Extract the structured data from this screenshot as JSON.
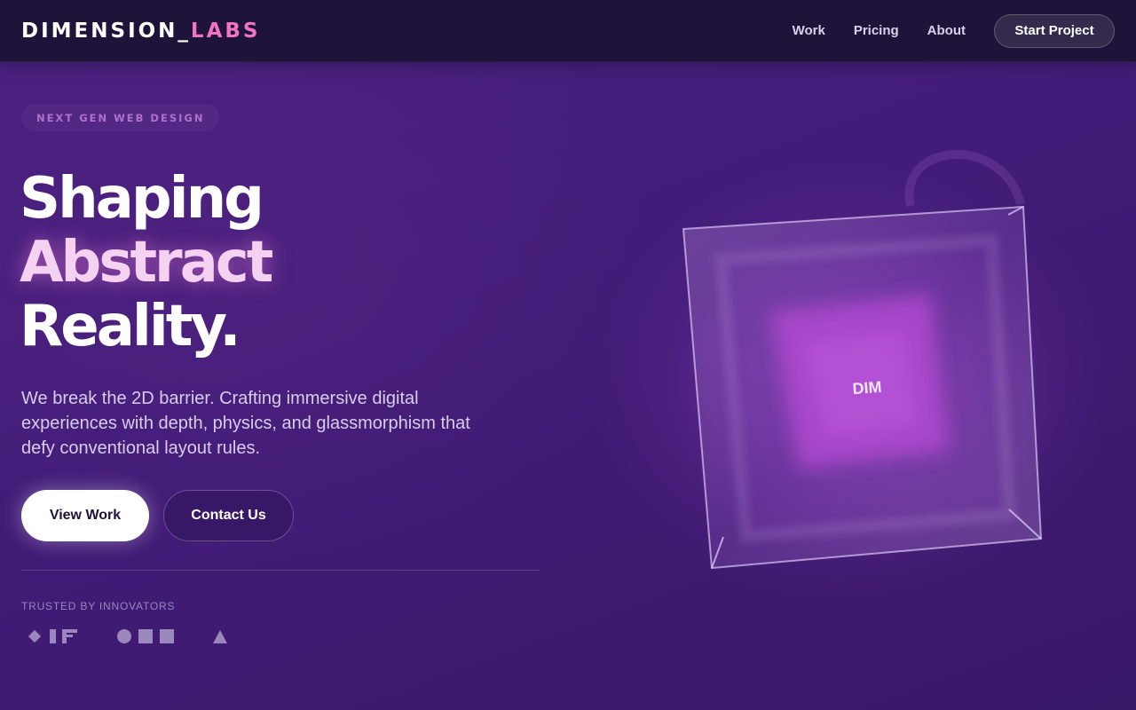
{
  "nav": {
    "logo_main": "DIMENSION",
    "logo_separator": "_",
    "logo_accent": "LABS",
    "links": [
      "Work",
      "Pricing",
      "About"
    ],
    "cta_label": "Start Project"
  },
  "hero": {
    "badge": "NEXT GEN WEB DESIGN",
    "headline_line1": "Shaping",
    "headline_line2": "Abstract",
    "headline_line3": "Reality.",
    "lead": "We break the 2D barrier. Crafting immersive digital experiences with depth, physics, and glassmorphism that defy conventional layout rules.",
    "primary_button": "View Work",
    "secondary_button": "Contact Us"
  },
  "trusted": {
    "label": "TRUSTED BY INNOVATORS",
    "logos": [
      "diamond-bar-f-logo",
      "circle-squares-logo",
      "triangle-logo"
    ]
  },
  "cube": {
    "center_label": "DIM"
  },
  "colors": {
    "background": "#421c78",
    "nav_background": "#1e1338",
    "logo_accent": "#f073c6",
    "headline_accent": "#f6d2f2",
    "cube_core": "#b04ad0",
    "muted_text": "#9a84c0"
  }
}
